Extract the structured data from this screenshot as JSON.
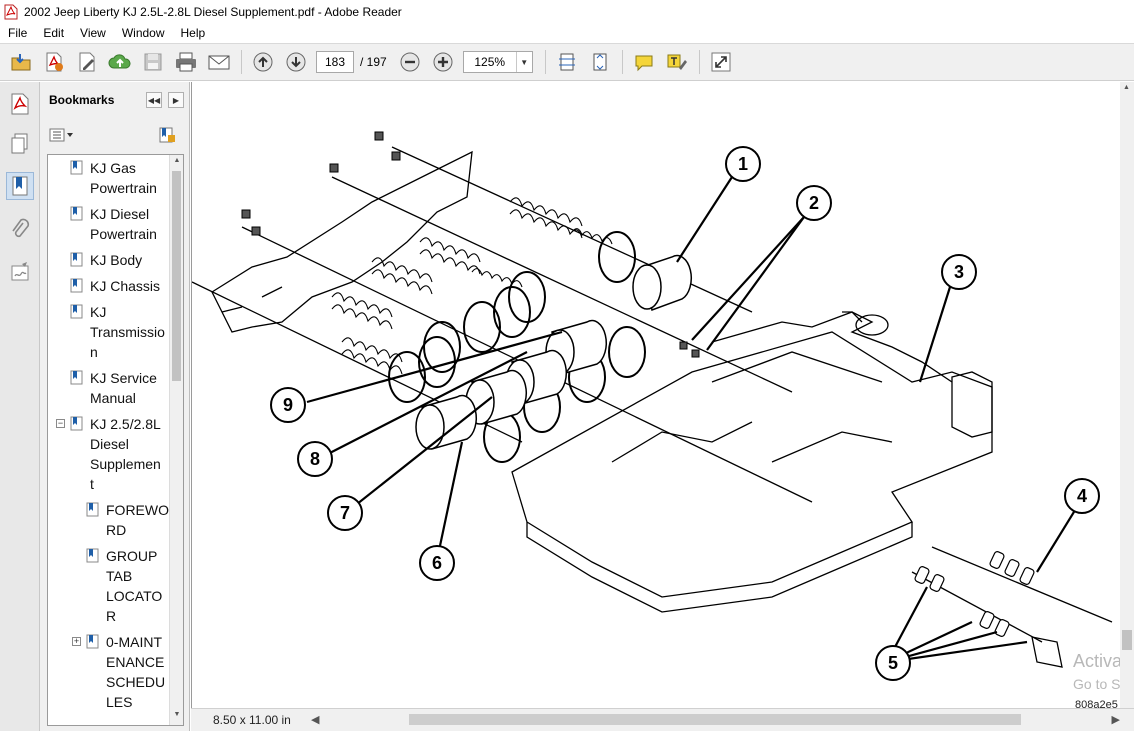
{
  "window": {
    "title": "2002 Jeep Liberty KJ 2.5L-2.8L Diesel Supplement.pdf - Adobe Reader"
  },
  "menu": [
    "File",
    "Edit",
    "View",
    "Window",
    "Help"
  ],
  "toolbar": {
    "page_current": "183",
    "page_total": "/ 197",
    "zoom": "125%"
  },
  "bookmarks": {
    "title": "Bookmarks",
    "items": [
      {
        "label": "KJ Gas\nPowertrain",
        "expandable": false
      },
      {
        "label": "KJ Diesel\nPowertrain",
        "expandable": false
      },
      {
        "label": "KJ Body",
        "expandable": false
      },
      {
        "label": "KJ Chassis",
        "expandable": false
      },
      {
        "label": "KJ\nTransmissio\nn",
        "expandable": false
      },
      {
        "label": "KJ Service\nManual",
        "expandable": false
      },
      {
        "label": "KJ 2.5/2.8L\nDiesel\nSupplemen\nt",
        "expandable": true,
        "expanded": true
      },
      {
        "label": "FOREWO\nRD",
        "expandable": false
      },
      {
        "label": "GROUP\nTAB\nLOCATO\nR",
        "expandable": false
      },
      {
        "label": "0-MAINT\nENANCE\nSCHEDU\nLES",
        "expandable": true,
        "expanded": false
      }
    ]
  },
  "document": {
    "callouts": [
      "1",
      "2",
      "3",
      "4",
      "5",
      "6",
      "7",
      "8",
      "9"
    ],
    "figure_code": "808a2e5",
    "watermark_line1": "Activat",
    "watermark_line2": "Go to Set"
  },
  "status": {
    "page_size": "8.50 x 11.00 in"
  },
  "colors": {
    "toolbar_bg": "#f0f0f0",
    "panel_bg": "#f0f0f0",
    "bookmark_icon": "#1f5fa8",
    "active_rail": "#cfe0f2"
  }
}
